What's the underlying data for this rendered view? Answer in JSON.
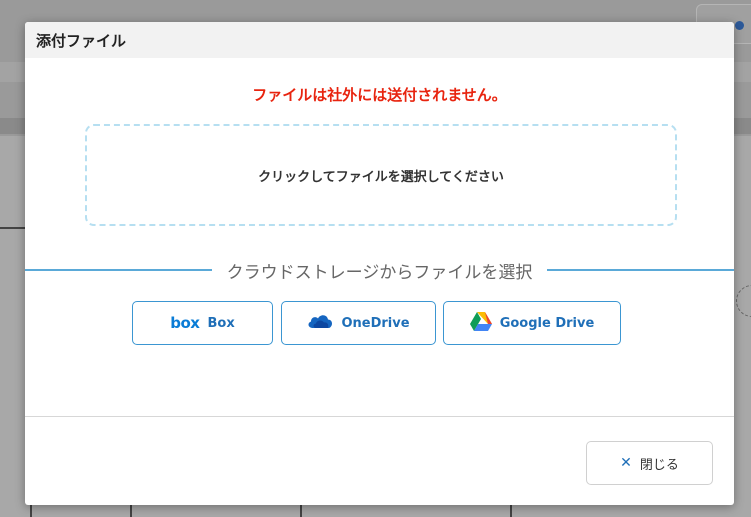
{
  "modal": {
    "title": "添付ファイル",
    "warning": "ファイルは社外には送付されません。",
    "dropzone_label": "クリックしてファイルを選択してください",
    "cloud_divider_label": "クラウドストレージからファイルを選択",
    "cloud_buttons": [
      {
        "label": "Box",
        "logo_text": "box",
        "icon": "box-logo-icon"
      },
      {
        "label": "OneDrive",
        "icon": "onedrive-cloud-icon"
      },
      {
        "label": "Google Drive",
        "icon": "google-drive-icon"
      }
    ],
    "close_label": "閉じる",
    "colors": {
      "warning": "#e8240f",
      "accent": "#3b96d2",
      "dropzone_border": "#b6dff1"
    }
  }
}
